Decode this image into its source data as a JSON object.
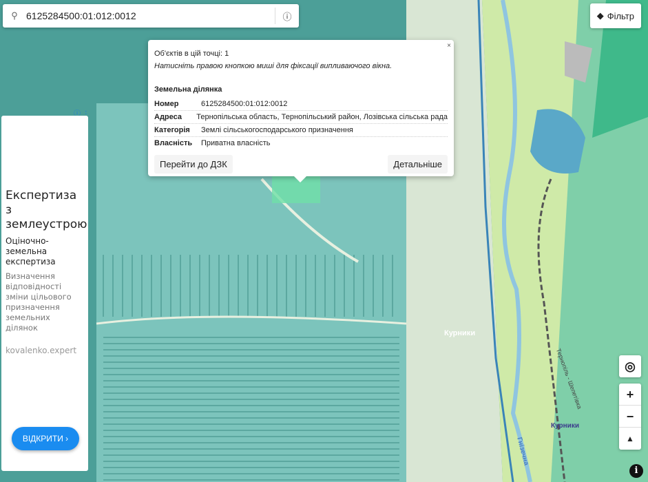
{
  "search": {
    "value": "6125284500:01:012:0012",
    "search_icon": "search-icon",
    "info_icon": "info-icon"
  },
  "filter": {
    "label": "Фільтр"
  },
  "popup": {
    "close": "×",
    "count": "Об'єктів в цій точці: 1",
    "hint": "Натисніть правою кнопкою миші для фіксації випливаючого вікна.",
    "section": "Земельна ділянка",
    "rows": [
      {
        "key": "Номер",
        "value": "6125284500:01:012:0012"
      },
      {
        "key": "Адреса",
        "value": "Тернопільська область, Тернопільський район, Лозівська сільська рада"
      },
      {
        "key": "Категорія",
        "value": "Землі сільськогосподарського призначення"
      },
      {
        "key": "Власність",
        "value": "Приватна власність"
      }
    ],
    "btn_dzk": "Перейти до ДЗК",
    "btn_details": "Детальніше"
  },
  "ad": {
    "title": "Експертиза з землеустрою",
    "subtitle": "Оціночно-земельна експертиза",
    "desc": "Визначення відповідності зміни цільового призначення земельних ділянок",
    "url": "kovalenko.expert",
    "open": "ВІДКРИТИ ›",
    "badge": "ⓘ ⋮"
  },
  "controls": {
    "locate": "◎",
    "zoom_in": "+",
    "zoom_out": "−",
    "north": "▲",
    "info": "i"
  },
  "map_labels": {
    "village": "Курники",
    "station": "Курники",
    "river": "Гнізечна",
    "railway": "Тернопіль - Шепетівка"
  }
}
